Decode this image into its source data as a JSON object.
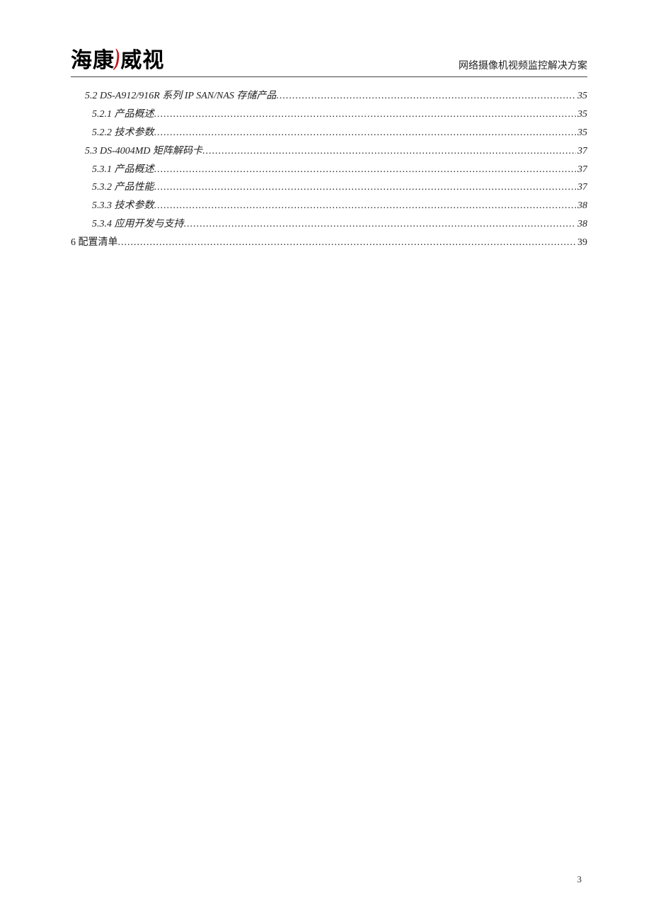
{
  "header": {
    "logo_left": "海康",
    "logo_right": "威视",
    "doc_title": "网络摄像机视频监控解决方案"
  },
  "toc": [
    {
      "label": "5.2 DS-A912/916R 系列 IP SAN/NAS 存储产品",
      "page": "35",
      "indent": 1,
      "italic": true
    },
    {
      "label": "5.2.1 产品概述",
      "page": "35",
      "indent": 2,
      "italic": true
    },
    {
      "label": "5.2.2 技术参数",
      "page": "35",
      "indent": 2,
      "italic": true
    },
    {
      "label": "5.3 DS-4004MD 矩阵解码卡",
      "page": "37",
      "indent": 1,
      "italic": true
    },
    {
      "label": "5.3.1 产品概述",
      "page": "37",
      "indent": 2,
      "italic": true
    },
    {
      "label": "5.3.2 产品性能",
      "page": "37",
      "indent": 2,
      "italic": true
    },
    {
      "label": "5.3.3 技术参数",
      "page": "38",
      "indent": 2,
      "italic": true
    },
    {
      "label": "5.3.4 应用开发与支持",
      "page": "38",
      "indent": 2,
      "italic": true
    },
    {
      "label": "6 配置清单",
      "page": "39",
      "indent": 0,
      "italic": false
    }
  ],
  "footer": {
    "page_number": "3"
  }
}
